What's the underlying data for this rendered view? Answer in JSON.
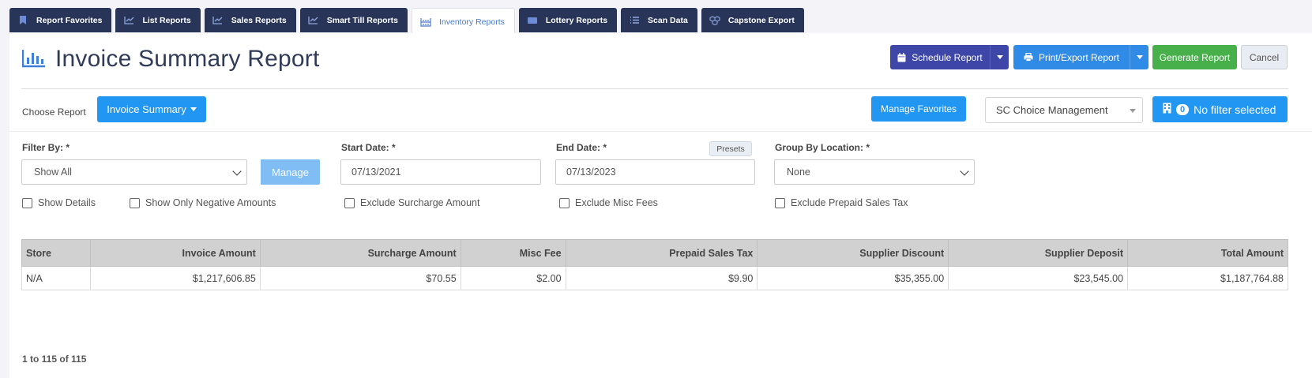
{
  "tabs": [
    {
      "label": "Report Favorites",
      "icon": "bookmark-icon",
      "active": false
    },
    {
      "label": "List Reports",
      "icon": "chart-line-icon",
      "active": false
    },
    {
      "label": "Sales Reports",
      "icon": "chart-line-icon",
      "active": false
    },
    {
      "label": "Smart Till Reports",
      "icon": "chart-line-icon",
      "active": false
    },
    {
      "label": "Inventory Reports",
      "icon": "inventory-icon",
      "active": true
    },
    {
      "label": "Lottery Reports",
      "icon": "ticket-icon",
      "active": false
    },
    {
      "label": "Scan Data",
      "icon": "list-icon",
      "active": false
    },
    {
      "label": "Capstone Export",
      "icon": "cubes-icon",
      "active": false
    }
  ],
  "header": {
    "title": "Invoice Summary Report",
    "schedule_label": "Schedule Report",
    "print_label": "Print/Export Report",
    "generate_label": "Generate Report",
    "cancel_label": "Cancel"
  },
  "choose": {
    "label": "Choose Report",
    "selected": "Invoice Summary"
  },
  "favorites_label": "Manage Favorites",
  "company_select": "SC Choice Management",
  "filter_button": {
    "count": "0",
    "label": "No filter selected"
  },
  "filters": {
    "filter_by_label": "Filter By: *",
    "filter_by_value": "Show All",
    "manage_label": "Manage",
    "start_label": "Start Date: *",
    "start_value": "07/13/2021",
    "end_label": "End Date: *",
    "end_value": "07/13/2023",
    "presets_label": "Presets",
    "group_label": "Group By Location: *",
    "group_value": "None"
  },
  "checkboxes": [
    {
      "label": "Show Details",
      "checked": false
    },
    {
      "label": "Show Only Negative Amounts",
      "checked": false
    },
    {
      "label": "Exclude Surcharge Amount",
      "checked": false
    },
    {
      "label": "Exclude Misc Fees",
      "checked": false
    },
    {
      "label": "Exclude Prepaid Sales Tax",
      "checked": false
    }
  ],
  "table": {
    "columns": [
      "Store",
      "Invoice Amount",
      "Surcharge Amount",
      "Misc Fee",
      "Prepaid Sales Tax",
      "Supplier Discount",
      "Supplier Deposit",
      "Total Amount"
    ],
    "rows": [
      [
        "N/A",
        "$1,217,606.85",
        "$70.55",
        "$2.00",
        "$9.90",
        "$35,355.00",
        "$23,545.00",
        "$1,187,764.88"
      ]
    ]
  },
  "paging": "1 to 115 of 115",
  "colors": {
    "tab_dark": "#283558",
    "schedule": "#3e47a8",
    "primary": "#2196f3",
    "generate": "#47b04b"
  }
}
